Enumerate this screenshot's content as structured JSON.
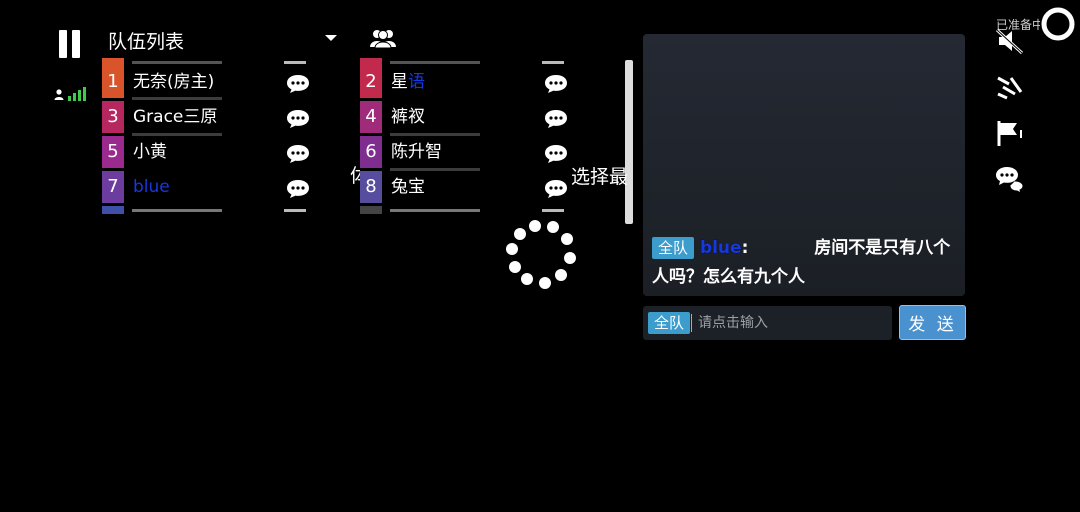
{
  "header": {
    "team_list_title": "队伍列表",
    "select_map_text": "选择最",
    "partial_glyph": "体",
    "top_right_text": "已准备中"
  },
  "players": {
    "left": [
      {
        "num": "1",
        "name": "无奈(房主)",
        "num_color": "#d9542b",
        "name_color": "#ffffff"
      },
      {
        "num": "3",
        "name": "Grace三原",
        "num_color": "#b6265f",
        "name_color": "#ffffff"
      },
      {
        "num": "5",
        "name": "小黄",
        "num_color": "#9a2a8d",
        "name_color": "#ffffff"
      },
      {
        "num": "7",
        "name": "blue",
        "num_color": "#6c3d9f",
        "name_color": "#1638e0"
      }
    ],
    "right": [
      {
        "num": "2",
        "name": "星",
        "name_suffix": "语",
        "num_color": "#c12a4c",
        "name_color": "#ffffff"
      },
      {
        "num": "4",
        "name": "裤衩",
        "num_color": "#a12b7b",
        "name_color": "#ffffff"
      },
      {
        "num": "6",
        "name": "陈升智",
        "num_color": "#7f2e8f",
        "name_color": "#ffffff"
      },
      {
        "num": "8",
        "name": "兔宝",
        "num_color": "#574d9e",
        "name_color": "#ffffff"
      }
    ]
  },
  "chat": {
    "messages": [
      {
        "channel": "全队",
        "sender": "blue",
        "separator": ":",
        "text": "房间不是只有八个人吗？怎么有九个人"
      }
    ],
    "input_channel": "全队",
    "input_placeholder": "请点击输入",
    "send_label": "发 送"
  },
  "colors": {
    "accent_blue": "#4a91d0",
    "tag_blue": "#3c9ccc",
    "signal_green": "#3fca4c"
  },
  "icons": {
    "pause": "pause-icon",
    "signal": "signal-icon",
    "dropdown": "chevron-down-icon",
    "team": "team-icon",
    "chat": "chat-bubble-icon",
    "mute": "mute-icon",
    "effects": "sparkle-icon",
    "flag": "flag-icon",
    "voice_chat": "voice-chat-icon",
    "ring": "ring-icon"
  }
}
